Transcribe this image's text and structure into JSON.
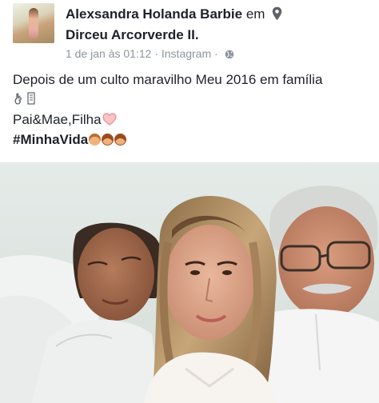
{
  "post": {
    "author": "Alexsandra Holanda Barbie",
    "connector": "em",
    "location": "Dirceu Arcorverde II.",
    "timestamp": "1 de jan às 01:12",
    "separator": "·",
    "source": "Instagram",
    "separator2": "·",
    "text_line1": "Depois de um culto maravilho Meu 2016 em família",
    "text_line3": "Pai&Mae,Filha",
    "hashtag": "#MinhaVida"
  },
  "icons": {
    "location": "location-pin-icon",
    "privacy": "globe-icon",
    "ok_hand": "ok-hand-icon",
    "heart": "heart-icon"
  },
  "colors": {
    "text": "#1d2129",
    "meta": "#8d949e",
    "heart": "#f4a3a8"
  }
}
